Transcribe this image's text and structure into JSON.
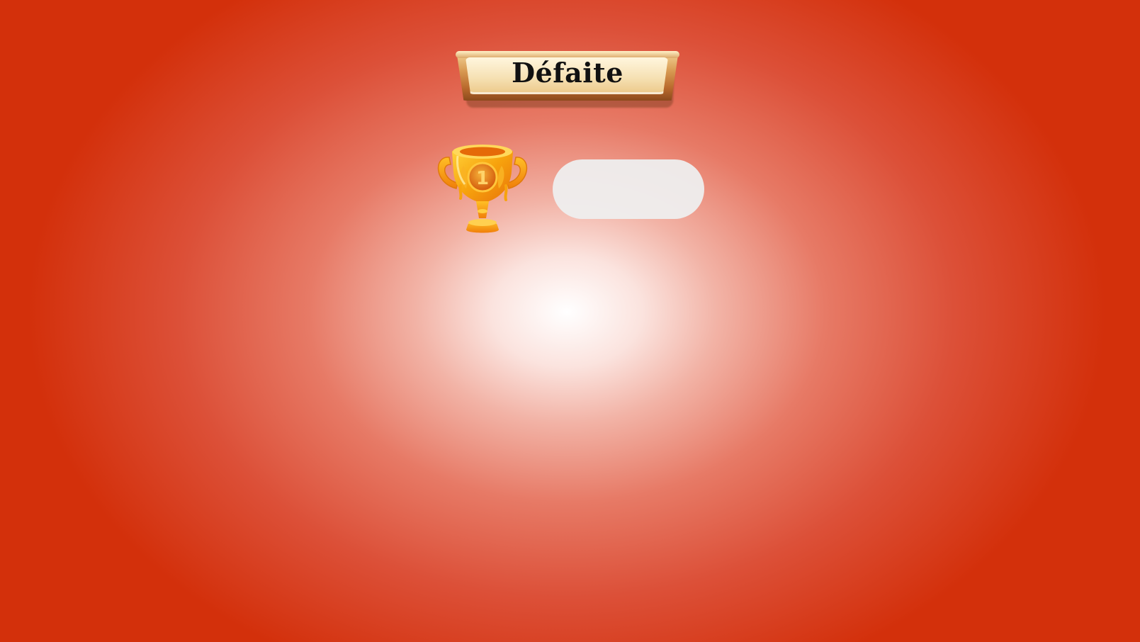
{
  "title": "Défaite",
  "trophy": {
    "icon": "trophy-icon",
    "rank": "1"
  },
  "score": {
    "value": ""
  },
  "colors": {
    "background_center": "#ffffff",
    "background_edge": "#d3300b",
    "banner_gold": "#d89a52",
    "banner_inner": "#f6e1b4",
    "trophy_gold": "#f5a10f",
    "pill": "#eeeeee"
  }
}
